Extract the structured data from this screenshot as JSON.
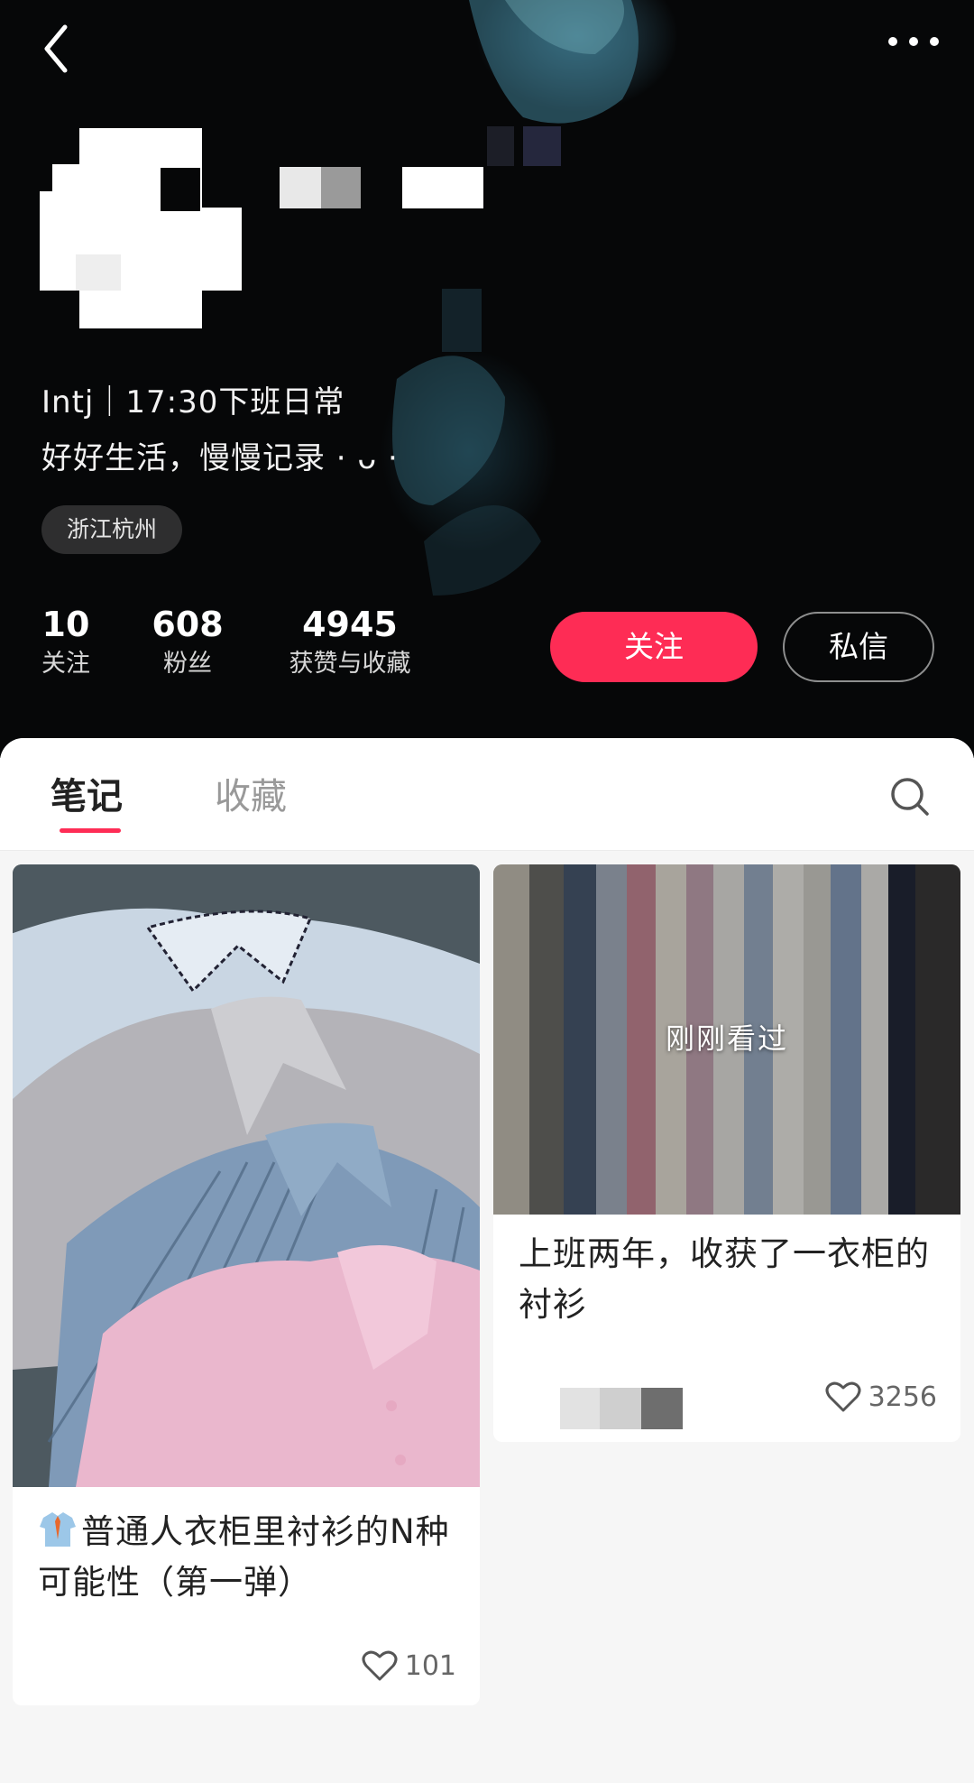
{
  "profile": {
    "bio_line1": "Intj｜17:30下班日常",
    "bio_line2": "好好生活，慢慢记录 · ᴗ ·",
    "location": "浙江杭州",
    "stats": [
      {
        "value": "10",
        "label": "关注"
      },
      {
        "value": "608",
        "label": "粉丝"
      },
      {
        "value": "4945",
        "label": "获赞与收藏"
      }
    ],
    "follow_label": "关注",
    "message_label": "私信"
  },
  "tabs": {
    "notes": "笔记",
    "collections": "收藏",
    "active": "notes"
  },
  "notes": [
    {
      "title": "普通人衣柜里衬衫的N种可能性（第一弹）",
      "likes": "101",
      "icon": "shirt-tie-icon"
    },
    {
      "title": "上班两年，收获了一衣柜的衬衫",
      "likes": "3256",
      "overlay": "刚刚看过"
    }
  ],
  "colors": {
    "accent": "#fe2c55",
    "header_bg": "#060708",
    "panel_bg": "#f6f6f6"
  }
}
